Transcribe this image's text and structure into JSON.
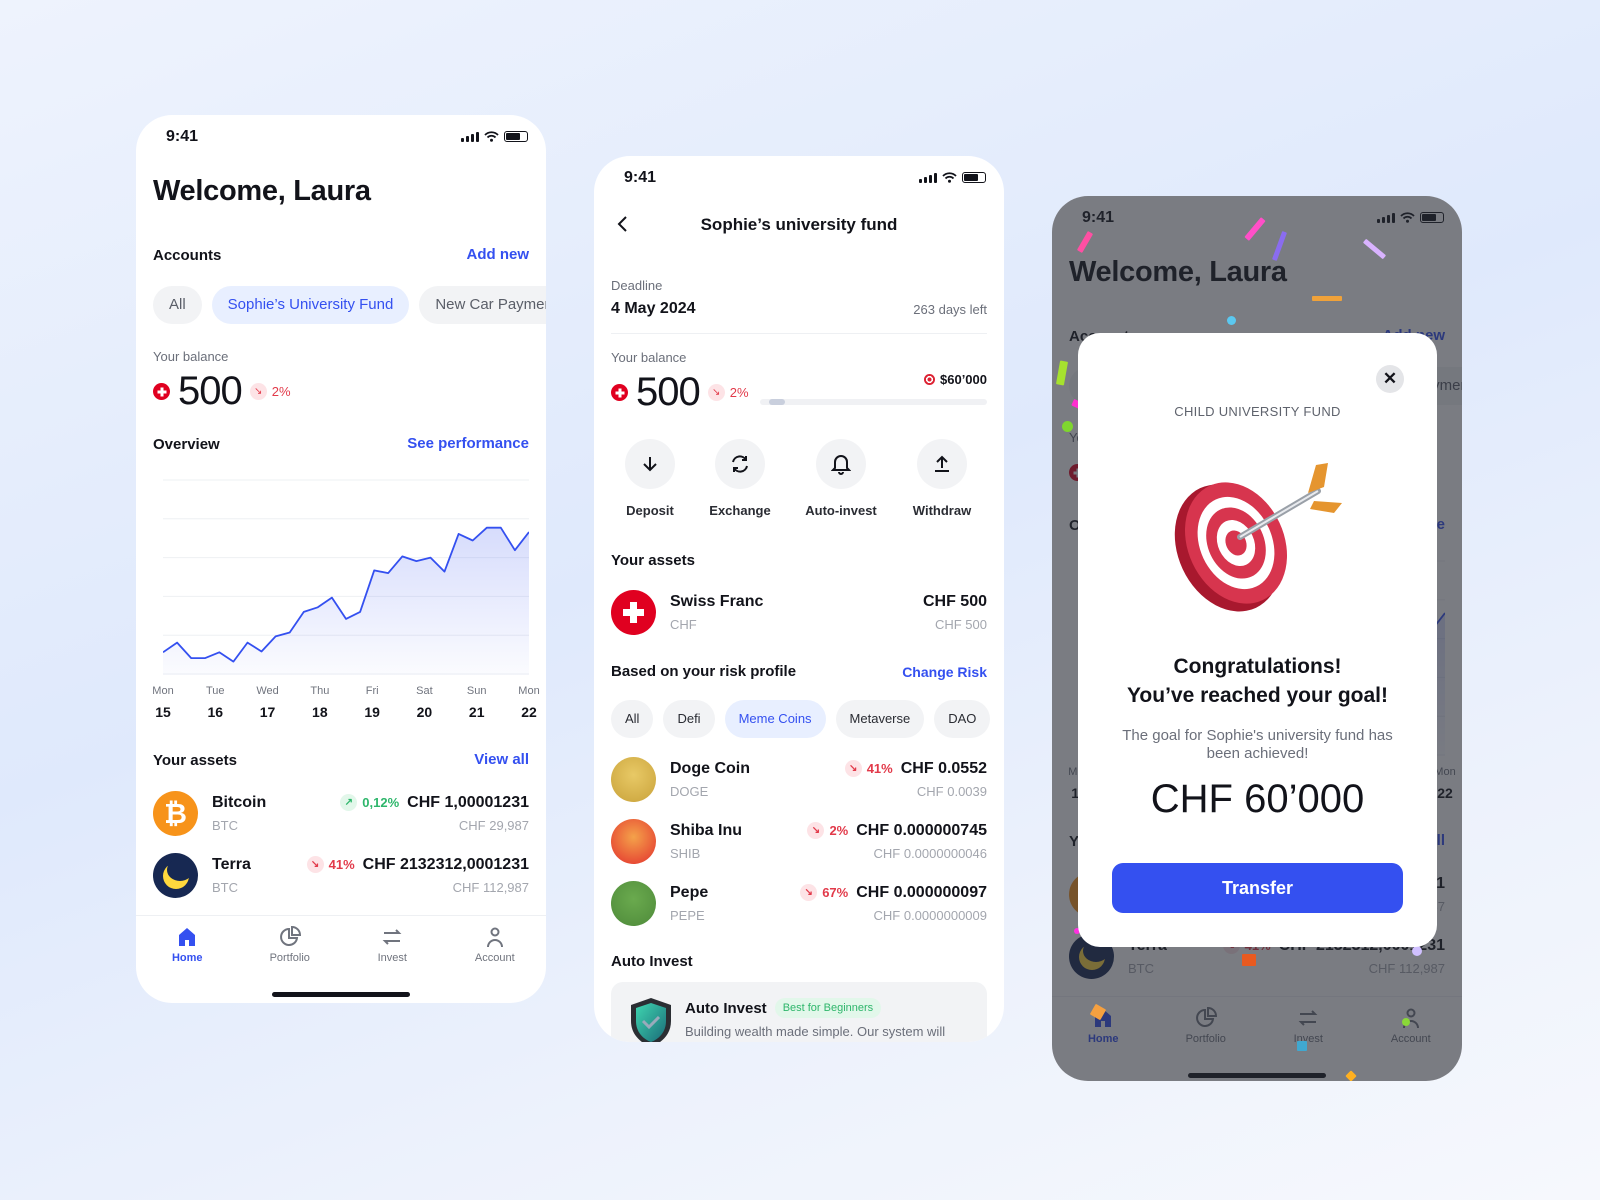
{
  "status_bar": {
    "time": "9:41"
  },
  "home": {
    "title": "Welcome, Laura",
    "accounts_label": "Accounts",
    "add_new": "Add new",
    "account_chips": [
      {
        "label": "All",
        "active": false
      },
      {
        "label": "Sophie’s University Fund",
        "active": true
      },
      {
        "label": "New Car Payment",
        "active": false
      }
    ],
    "balance_label": "Your balance",
    "balance": "500",
    "balance_change": "2%",
    "overview_label": "Overview",
    "see_performance": "See performance",
    "assets_label": "Your assets",
    "view_all": "View all",
    "assets": [
      {
        "name": "Bitcoin",
        "ticker": "BTC",
        "change": "0,12%",
        "direction": "up",
        "value": "CHF 1,00001231",
        "sub_value": "CHF 29,987",
        "icon": "bitcoin-icon"
      },
      {
        "name": "Terra",
        "ticker": "BTC",
        "change": "41%",
        "direction": "down",
        "value": "CHF 2132312,0001231",
        "sub_value": "CHF 112,987",
        "icon": "terra-icon"
      }
    ]
  },
  "chart_data": {
    "type": "area",
    "categories": [
      {
        "day": "Mon",
        "date": "15"
      },
      {
        "day": "Tue",
        "date": "16"
      },
      {
        "day": "Wed",
        "date": "17"
      },
      {
        "day": "Thu",
        "date": "18"
      },
      {
        "day": "Fri",
        "date": "19"
      },
      {
        "day": "Sat",
        "date": "20"
      },
      {
        "day": "Sun",
        "date": "21"
      },
      {
        "day": "Mon",
        "date": "22"
      }
    ],
    "values": [
      0.56,
      0.81,
      0.41,
      0.41,
      0.56,
      0.32,
      0.81,
      0.58,
      0.97,
      1.07,
      1.6,
      1.72,
      1.97,
      1.42,
      1.6,
      2.67,
      2.6,
      3.03,
      2.91,
      3.0,
      2.64,
      3.61,
      3.44,
      3.77,
      3.77,
      3.19,
      3.66
    ],
    "ylim": [
      0,
      5
    ],
    "grid": true,
    "color": "#3450f0"
  },
  "nav": [
    {
      "label": "Home",
      "icon": "home-icon",
      "active": true
    },
    {
      "label": "Portfolio",
      "icon": "pie-chart-icon",
      "active": false
    },
    {
      "label": "Invest",
      "icon": "swap-icon",
      "active": false
    },
    {
      "label": "Account",
      "icon": "user-icon",
      "active": false
    }
  ],
  "fund": {
    "title": "Sophie’s university fund",
    "deadline_label": "Deadline",
    "deadline": "4 May 2024",
    "days_left": "263 days left",
    "balance_label": "Your balance",
    "balance": "500",
    "balance_change": "2%",
    "goal": "$60’000",
    "progress": 0.07,
    "actions": [
      {
        "label": "Deposit",
        "icon": "arrow-down-icon"
      },
      {
        "label": "Exchange",
        "icon": "refresh-icon"
      },
      {
        "label": "Auto-invest",
        "icon": "bell-icon"
      },
      {
        "label": "Withdraw",
        "icon": "upload-icon"
      }
    ],
    "assets_label": "Your assets",
    "asset": {
      "name": "Swiss Franc",
      "ticker": "CHF",
      "value": "CHF 500",
      "sub_value": "CHF 500"
    },
    "risk_label": "Based on your risk profile",
    "change_risk": "Change Risk",
    "risk_chips": [
      {
        "label": "All",
        "active": false
      },
      {
        "label": "Defi",
        "active": false
      },
      {
        "label": "Meme Coins",
        "active": true
      },
      {
        "label": "Metaverse",
        "active": false
      },
      {
        "label": "DAO",
        "active": false
      }
    ],
    "coins": [
      {
        "name": "Doge Coin",
        "ticker": "DOGE",
        "change": "41%",
        "value": "CHF 0.0552",
        "sub_value": "CHF 0.0039"
      },
      {
        "name": "Shiba Inu",
        "ticker": "SHIB",
        "change": "2%",
        "value": "CHF 0.000000745",
        "sub_value": "CHF 0.0000000046"
      },
      {
        "name": "Pepe",
        "ticker": "PEPE",
        "change": "67%",
        "value": "CHF 0.000000097",
        "sub_value": "CHF 0.0000000009"
      }
    ],
    "auto_invest_label": "Auto Invest",
    "auto_invest_card": {
      "title": "Auto Invest",
      "badge": "Best for Beginners",
      "description": "Building wealth made simple. Our system will"
    }
  },
  "modal": {
    "eyebrow": "CHILD UNIVERSITY FUND",
    "heading_1": "Congratulations!",
    "heading_2": "You’ve reached your goal!",
    "description": "The goal for Sophie's university fund has been achieved!",
    "amount": "CHF 60’000",
    "button": "Transfer",
    "button_color": "#3450f0"
  }
}
